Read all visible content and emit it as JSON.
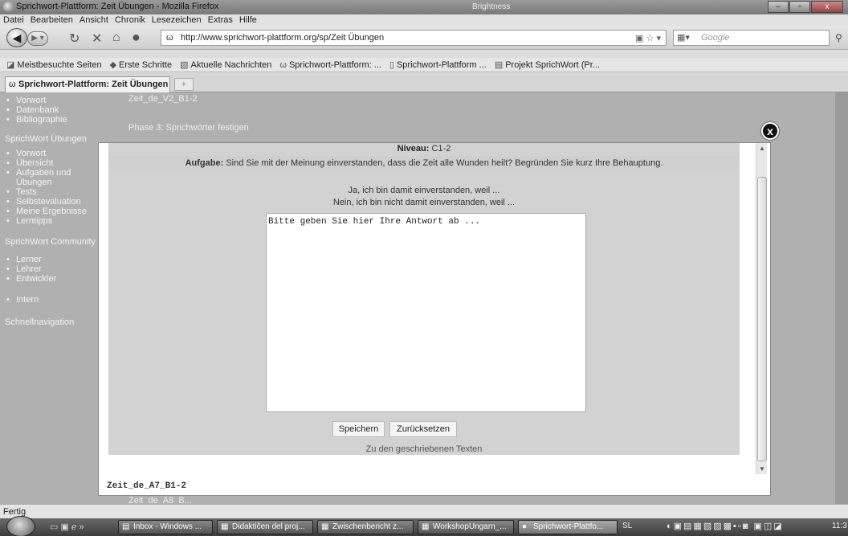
{
  "window": {
    "title": "Sprichwort-Plattform: Zeit Übungen - Mozilla Firefox",
    "brightness": "Brightness",
    "controls": [
      "–",
      "▫",
      "x"
    ]
  },
  "menu": [
    "Datei",
    "Bearbeiten",
    "Ansicht",
    "Chronik",
    "Lesezeichen",
    "Extras",
    "Hilfe"
  ],
  "nav": {
    "url": "http://www.sprichwort-plattform.org/sp/Zeit Übungen",
    "search_placeholder": "Google"
  },
  "bookmarks": [
    "Meistbesuchte Seiten",
    "Erste Schritte",
    "Aktuelle Nachrichten",
    "Sprichwort-Plattform: ...",
    "Sprichwort-Plattform ...",
    "Projekt SprichWort (Pr..."
  ],
  "tab": {
    "label": "Sprichwort-Plattform: Zeit Übungen",
    "new": "+"
  },
  "sidebar": {
    "top_items": [
      "Vorwort",
      "Datenbank",
      "Bibliographie"
    ],
    "section1": "SprichWort Übungen",
    "section1_items": [
      "Vorwort",
      "Übersicht",
      "Aufgaben und Übungen",
      "Tests",
      "Selbstevaluation",
      "Meine Ergebnisse",
      "Lerntipps"
    ],
    "section2": "SprichWort Community",
    "section2_items": [
      "Lerner",
      "Lehrer",
      "Entwickler"
    ],
    "section2_extra": "Intern",
    "section3": "Schnellnavigation"
  },
  "background": {
    "line1": "Zeit_de_V2_B1-2",
    "line2": "Phase 3: Sprichwörter festigen",
    "line3": "Zeit_de_A8_B..."
  },
  "modal": {
    "niveau_label": "Niveau:",
    "niveau_value": "C1-2",
    "task_label": "Aufgabe:",
    "task_text": "Sind Sie mit der Meinung einverstanden, dass die Zeit alle Wunden heilt? Begründen Sie kurz Ihre Behauptung.",
    "option_yes": "Ja, ich bin damit einverstanden, weil ...",
    "option_no": "Nein, ich bin nicht damit einverstanden, weil ...",
    "answer_text": "Bitte geben Sie hier Ihre Antwort ab ...",
    "save_button": "Speichern",
    "reset_button": "Zurücksetzen",
    "written_link": "Zu den geschriebenen Texten",
    "filename": "Zeit_de_A7_B1-2",
    "close": "x"
  },
  "status": "Fertig",
  "taskbar": {
    "buttons": [
      "Inbox - Windows ...",
      "Didaktičen del proj...",
      "Zwischenbericht z...",
      "WorkshopUngarn_...",
      "Sprichwort-Plattfo..."
    ],
    "language": "SL",
    "clock": "11:3"
  }
}
